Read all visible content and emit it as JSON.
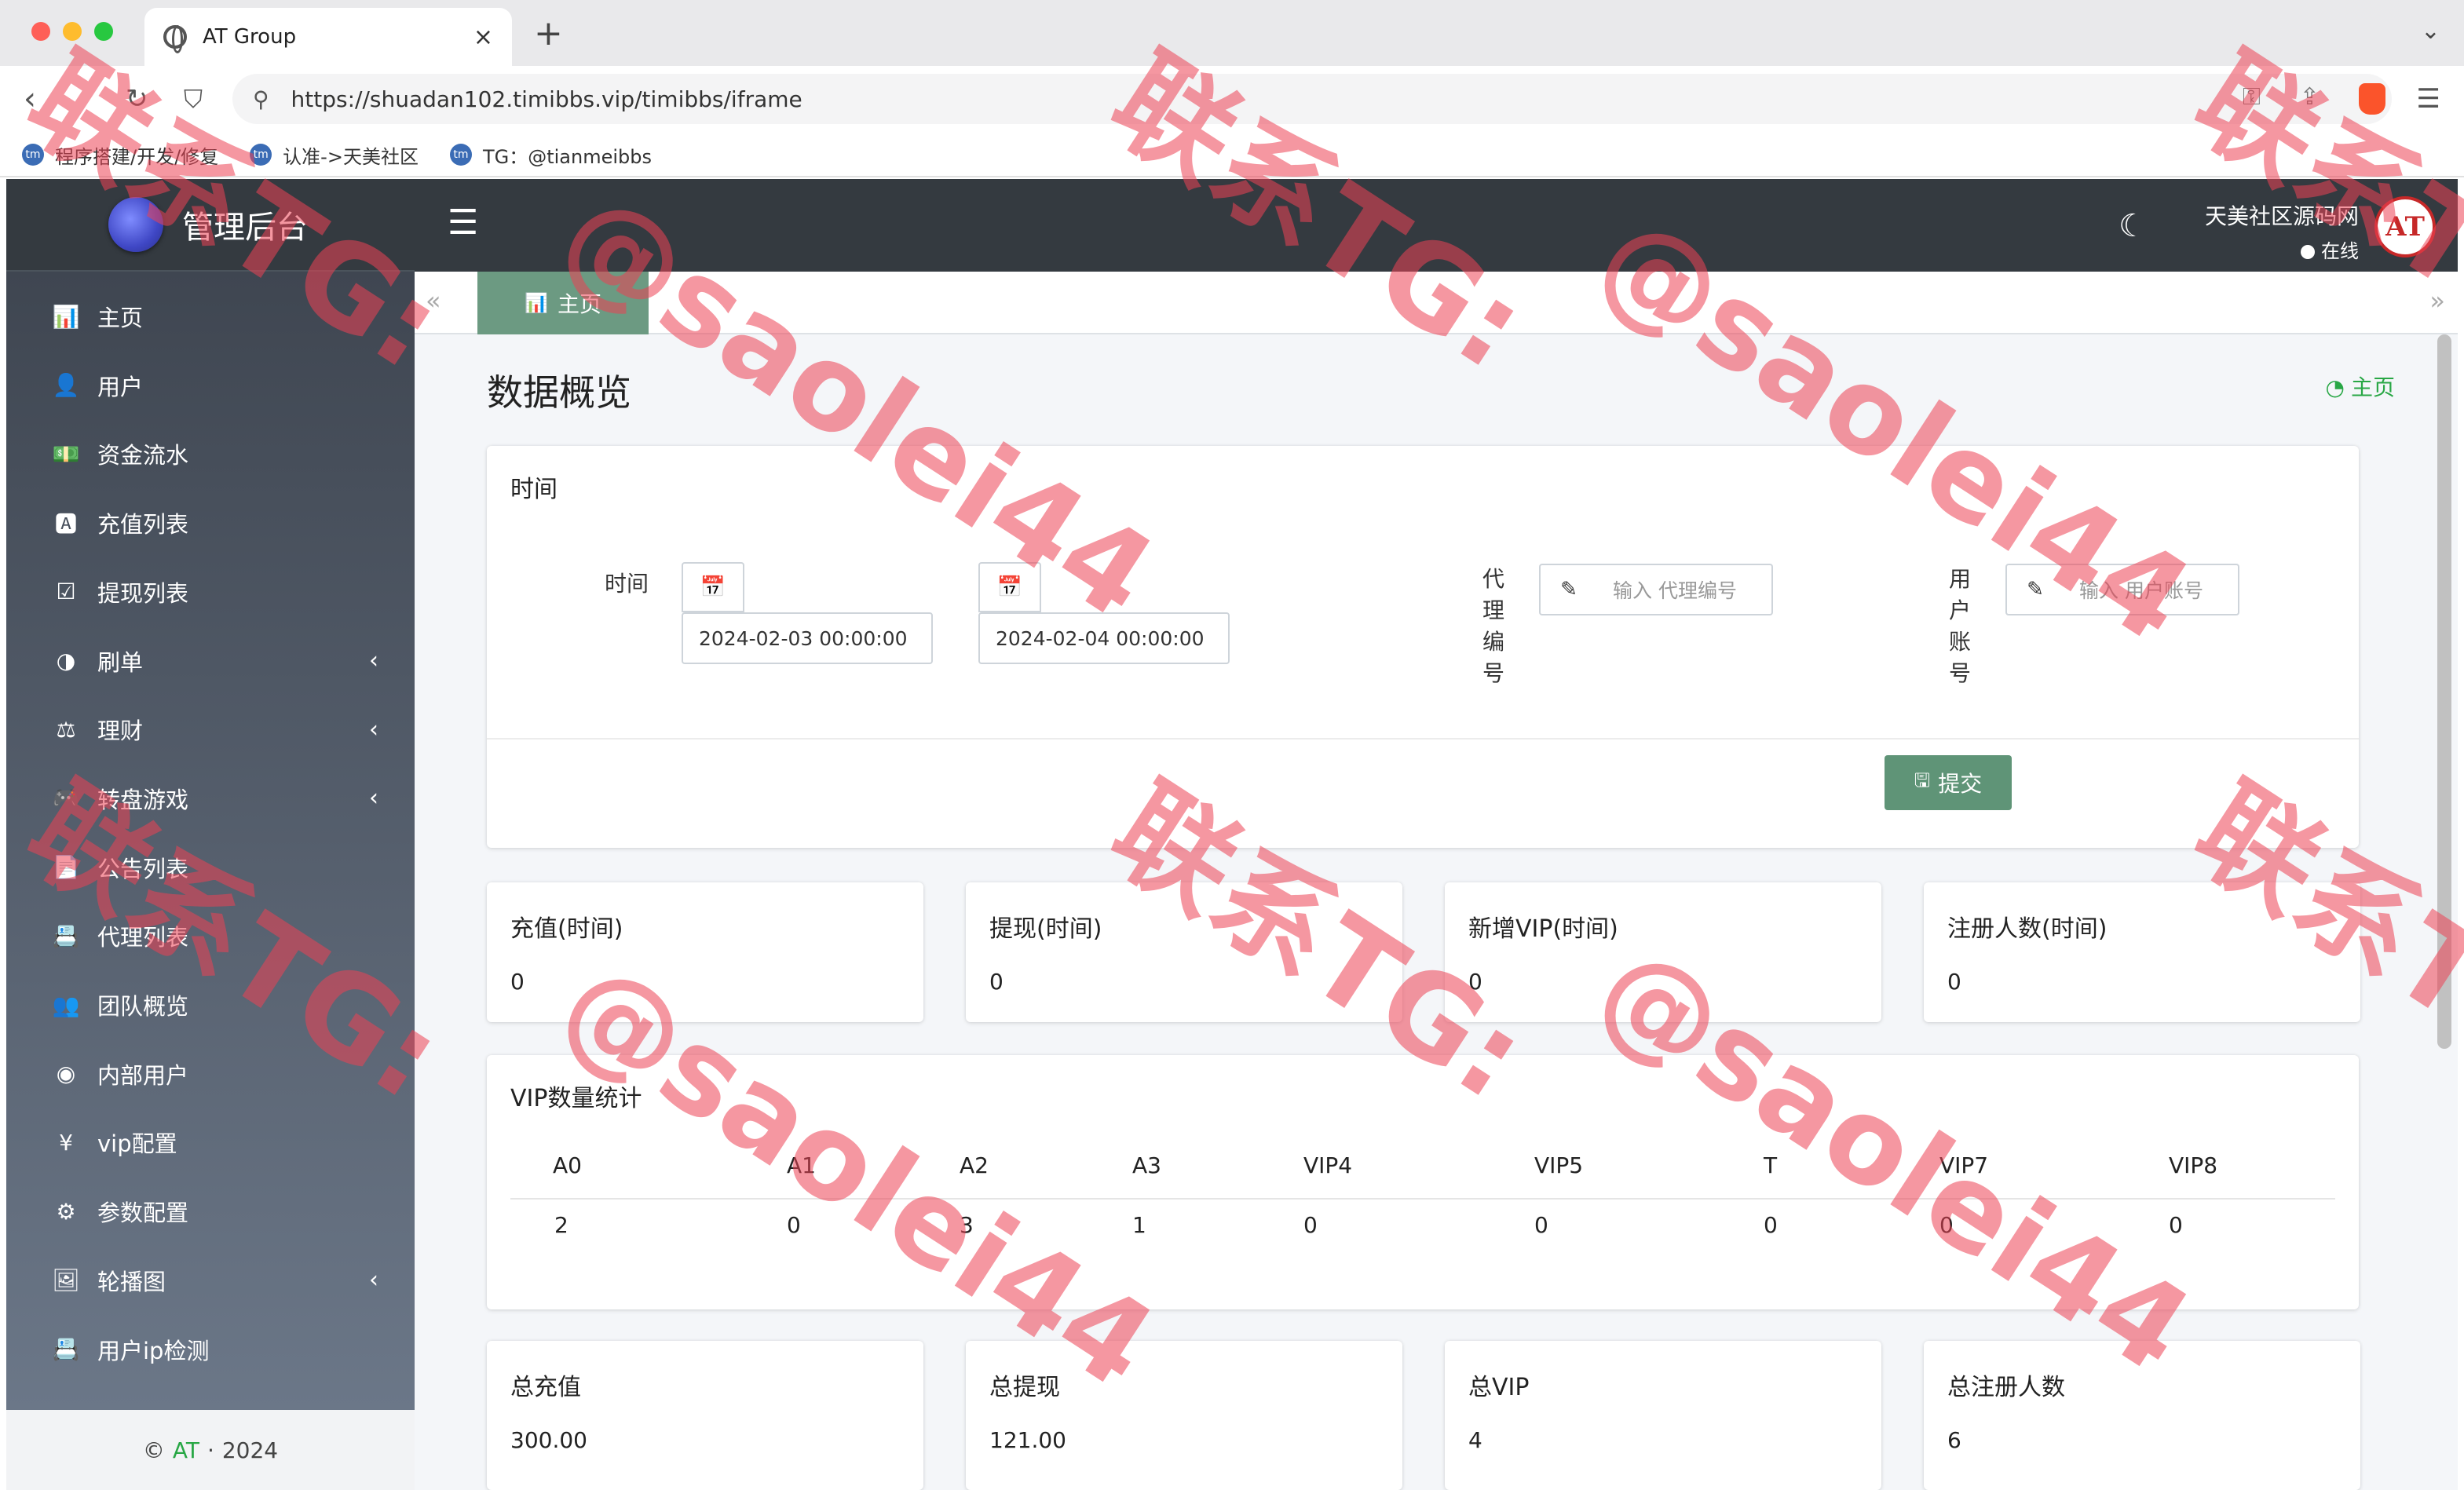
{
  "browser": {
    "tab_title": "AT Group",
    "tab_close": "×",
    "new_tab": "+",
    "url": "https://shuadan102.timibbs.vip/timibbs/iframe",
    "bookmarks": [
      {
        "label": "程序搭建/开发/修复"
      },
      {
        "label": "认准->天美社区"
      },
      {
        "label": "TG：@tianmeibbs"
      }
    ]
  },
  "header": {
    "brand": "管理后台",
    "user_name": "天美社区源码网",
    "user_status": "在线",
    "avatar_text": "AT"
  },
  "sidebar": {
    "items": [
      {
        "label": "主页",
        "icon": "bar-chart-icon",
        "glyph": "📊"
      },
      {
        "label": "用户",
        "icon": "user-icon",
        "glyph": "👤"
      },
      {
        "label": "资金流水",
        "icon": "money-icon",
        "glyph": "💵"
      },
      {
        "label": "充值列表",
        "icon": "recharge-icon",
        "glyph": "🅰"
      },
      {
        "label": "提现列表",
        "icon": "check-square-icon",
        "glyph": "☑"
      },
      {
        "label": "刷单",
        "icon": "half-circle-icon",
        "glyph": "◑",
        "chevron": "‹"
      },
      {
        "label": "理财",
        "icon": "finance-icon",
        "glyph": "⚖",
        "chevron": "‹"
      },
      {
        "label": "转盘游戏",
        "icon": "gamepad-icon",
        "glyph": "🎮",
        "chevron": "‹"
      },
      {
        "label": "公告列表",
        "icon": "document-icon",
        "glyph": "📄"
      },
      {
        "label": "代理列表",
        "icon": "contact-card-icon",
        "glyph": "📇"
      },
      {
        "label": "团队概览",
        "icon": "team-icon",
        "glyph": "👥"
      },
      {
        "label": "内部用户",
        "icon": "user-circle-icon",
        "glyph": "◉"
      },
      {
        "label": "vip配置",
        "icon": "yen-icon",
        "glyph": "¥"
      },
      {
        "label": "参数配置",
        "icon": "gears-icon",
        "glyph": "⚙"
      },
      {
        "label": "轮播图",
        "icon": "image-icon",
        "glyph": "🖼",
        "chevron": "‹"
      },
      {
        "label": "用户ip检测",
        "icon": "id-badge-icon",
        "glyph": "📇"
      }
    ],
    "footer": {
      "copyright": "©",
      "brand": "AT",
      "separator": "·",
      "year": "2024"
    }
  },
  "tabs": {
    "active": "主页"
  },
  "page": {
    "title": "数据概览",
    "breadcrumb": "主页"
  },
  "filter": {
    "card_title": "时间",
    "time_label": "时间",
    "start_date": "2024-02-03 00:00:00",
    "end_date": "2024-02-04 00:00:00",
    "agent_label": [
      "代",
      "理",
      "编",
      "号"
    ],
    "agent_placeholder": "输入 代理编号",
    "user_label": [
      "用",
      "户",
      "账",
      "号"
    ],
    "user_placeholder": "输入 用户账号",
    "submit": "提交"
  },
  "period_stats": [
    {
      "label": "充值(时间)",
      "value": "0"
    },
    {
      "label": "提现(时间)",
      "value": "0"
    },
    {
      "label": "新增VIP(时间)",
      "value": "0"
    },
    {
      "label": "注册人数(时间)",
      "value": "0"
    }
  ],
  "vip_stats": {
    "title": "VIP数量统计",
    "headers": [
      "A0",
      "A1",
      "A2",
      "A3",
      "VIP4",
      "VIP5",
      "T",
      "VIP7",
      "VIP8"
    ],
    "values": [
      "2",
      "0",
      "3",
      "1",
      "0",
      "0",
      "0",
      "0",
      "0"
    ]
  },
  "totals": [
    {
      "label": "总充值",
      "value": "300.00"
    },
    {
      "label": "总提现",
      "value": "121.00"
    },
    {
      "label": "总VIP",
      "value": "4"
    },
    {
      "label": "总注册人数",
      "value": "6"
    }
  ],
  "watermark": {
    "line1": "联系TG:",
    "line2": "@saolei44"
  }
}
